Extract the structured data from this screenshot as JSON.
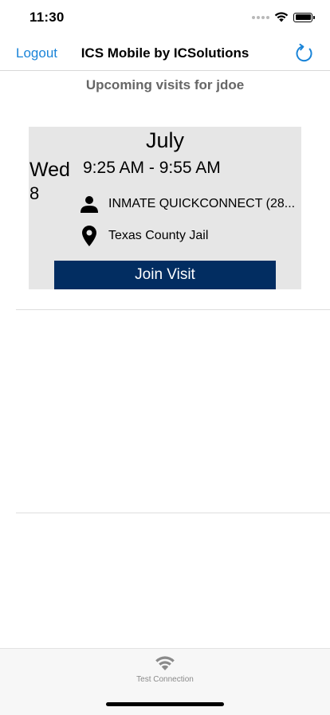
{
  "status_bar": {
    "time": "11:30"
  },
  "nav": {
    "logout_label": "Logout",
    "title": "ICS Mobile by ICSolutions"
  },
  "subtitle": "Upcoming visits for jdoe",
  "visit": {
    "month": "July",
    "weekday": "Wed",
    "day": "8",
    "time_range": "9:25 AM - 9:55 AM",
    "inmate": "INMATE QUICKCONNECT (28...",
    "location": "Texas County Jail",
    "join_label": "Join Visit"
  },
  "tab_bar": {
    "items": [
      {
        "label": "Test Connection",
        "icon": "wifi-icon"
      }
    ]
  },
  "colors": {
    "accent": "#1a84d8",
    "button": "#022d61",
    "card": "#e6e6e6",
    "subtitle": "#666666"
  }
}
